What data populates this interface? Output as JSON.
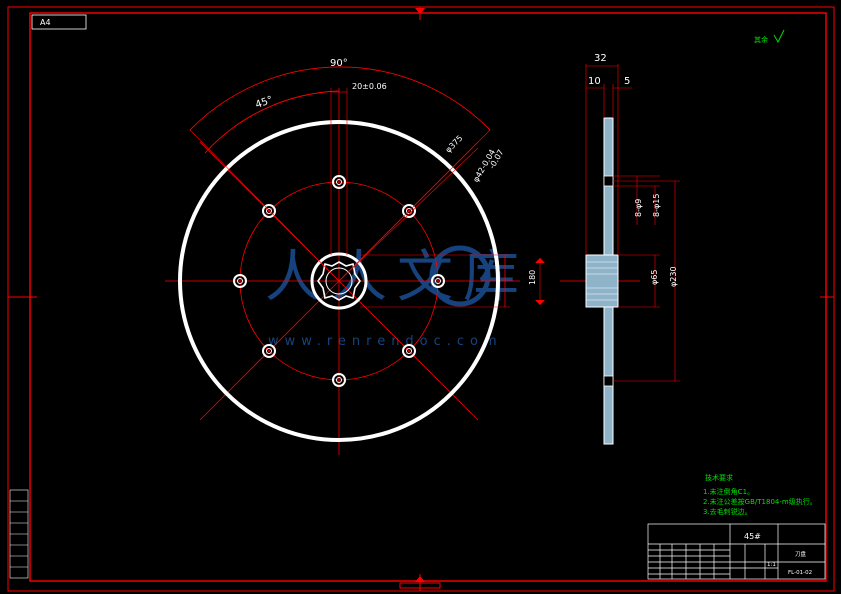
{
  "sheet": {
    "size_label": "A4",
    "roughness_note": "其余",
    "colors": {
      "background": "#000000",
      "frame": "#ff0000",
      "part": "#ffffff",
      "centerline": "#ff0000",
      "notes": "#00e000",
      "shaft": "#1e90ff"
    }
  },
  "front_view": {
    "angle_total": "90°",
    "angle_half": "45°",
    "keyway_width": "20±0.06",
    "outer_diameter": "φ375",
    "bolt_circle": "φ42-0.04",
    "bolt_circle_tol": "-0.07",
    "hub_dim": "180"
  },
  "side_view": {
    "thickness_total": "32",
    "hub_offset": "10",
    "plate_thickness": "5",
    "hole_small": "8-φ9",
    "hole_large": "8-φ15",
    "hub_diameter": "φ65",
    "pitch_diameter": "φ230"
  },
  "tech_requirements": {
    "title": "技术要求",
    "items": [
      "1.未注倒角C1。",
      "2.未注公差按GB/T1804-m级执行。",
      "3.去毛刺锐边。"
    ]
  },
  "title_block": {
    "material": "45#",
    "part_name": "刀盘",
    "drawing_no": "FL-01-02",
    "scale": "1:1"
  },
  "watermark": {
    "brand": "人人文库",
    "url": "www.renrendoc.com"
  }
}
